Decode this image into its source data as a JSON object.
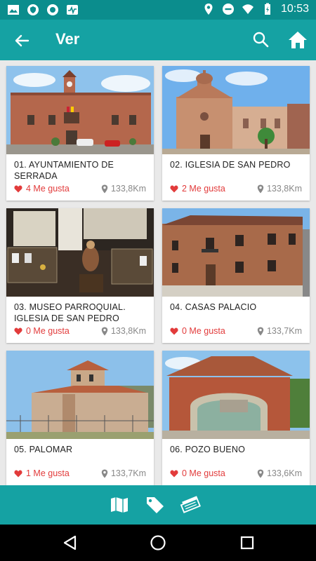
{
  "status_bar": {
    "time": "10:53"
  },
  "app_bar": {
    "title": "Ver"
  },
  "places": [
    {
      "name": "01. AYUNTAMIENTO DE SERRADA",
      "likes": "4 Me gusta",
      "distance": "133,8Km"
    },
    {
      "name": "02. IGLESIA DE SAN PEDRO",
      "likes": "2 Me gusta",
      "distance": "133,8Km"
    },
    {
      "name": "03. MUSEO PARROQUIAL. IGLESIA DE SAN PEDRO",
      "likes": "0 Me gusta",
      "distance": "133,8Km"
    },
    {
      "name": "04. CASAS PALACIO",
      "likes": "0 Me gusta",
      "distance": "133,7Km"
    },
    {
      "name": "05. PALOMAR",
      "likes": "1 Me gusta",
      "distance": "133,7Km"
    },
    {
      "name": "06. POZO BUENO",
      "likes": "0 Me gusta",
      "distance": "133,6Km"
    }
  ],
  "colors": {
    "primary": "#15a2a3",
    "primary_dark": "#0b8d8d",
    "like": "#e23b3b"
  }
}
